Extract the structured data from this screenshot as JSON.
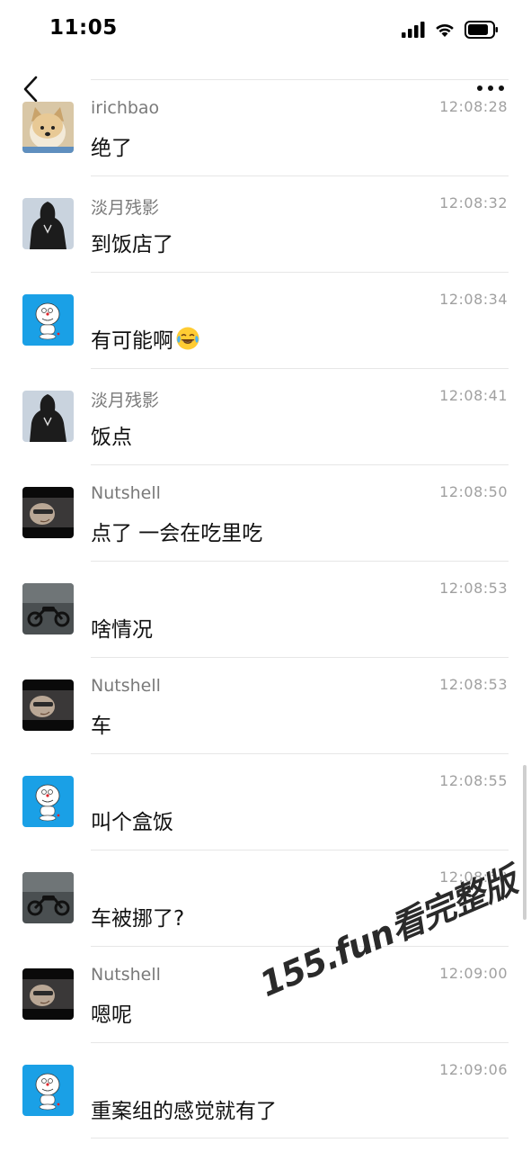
{
  "status": {
    "time": "11:05"
  },
  "messages": [
    {
      "sender": "irichbao",
      "time": "12:08:28",
      "text": "绝了",
      "avatar": "shiba-dog"
    },
    {
      "sender": "淡月残影",
      "time": "12:08:32",
      "text": "到饭店了",
      "avatar": "hooded-figure"
    },
    {
      "sender": "",
      "time": "12:08:34",
      "text": "有可能啊",
      "avatar": "doraemon",
      "emoji": "laughing-tears-emoji"
    },
    {
      "sender": "淡月残影",
      "time": "12:08:41",
      "text": "饭点",
      "avatar": "hooded-figure"
    },
    {
      "sender": "Nutshell",
      "time": "12:08:50",
      "text": "点了 一会在吃里吃",
      "avatar": "face-dark"
    },
    {
      "sender": "",
      "time": "12:08:53",
      "text": "啥情况",
      "avatar": "motorcycle"
    },
    {
      "sender": "Nutshell",
      "time": "12:08:53",
      "text": "车",
      "avatar": "face-dark"
    },
    {
      "sender": "",
      "time": "12:08:55",
      "text": "叫个盒饭",
      "avatar": "doraemon"
    },
    {
      "sender": "",
      "time": "12:08:58",
      "text": "车被挪了?",
      "avatar": "motorcycle"
    },
    {
      "sender": "Nutshell",
      "time": "12:09:00",
      "text": "嗯呢",
      "avatar": "face-dark"
    },
    {
      "sender": "",
      "time": "12:09:06",
      "text": "重案组的感觉就有了",
      "avatar": "doraemon"
    }
  ],
  "watermark": "155.fun看完整版"
}
